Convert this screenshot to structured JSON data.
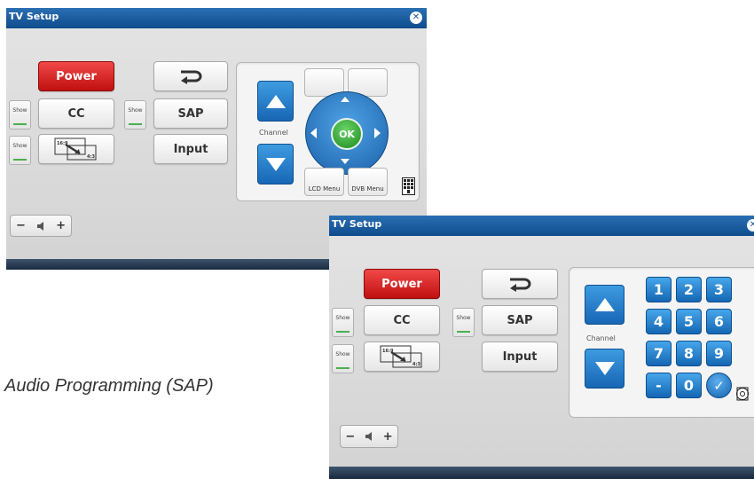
{
  "colors": {
    "titlebar": "#1a5a9a",
    "power": "#d42020",
    "channel_blue": "#2a83d2",
    "ok_green": "#2fa52f",
    "indicator_green": "#4caf50"
  },
  "window1": {
    "title": "TV Setup",
    "close_icon": "close-x-icon",
    "buttons": {
      "power": "Power",
      "cc": "CC",
      "sap": "SAP",
      "input": "Input",
      "back_icon": "return-arrow-icon"
    },
    "show_labels": [
      "Show",
      "Show",
      "Show"
    ],
    "aspect": {
      "a": "16:9",
      "b": "4:3"
    },
    "nav": {
      "channel_label": "Channel",
      "ok": "OK",
      "lcd_menu": "LCD Menu",
      "dvb_menu": "DVB Menu",
      "keypad_icon": "keypad-icon"
    },
    "volume": {
      "minus": "−",
      "icon": "speaker-icon",
      "plus": "+"
    }
  },
  "window2": {
    "title": "TV Setup",
    "close_icon": "close-x-icon",
    "buttons": {
      "power": "Power",
      "cc": "CC",
      "sap": "SAP",
      "input": "Input",
      "back_icon": "return-arrow-icon"
    },
    "show_labels": [
      "Show",
      "Show",
      "Show"
    ],
    "aspect": {
      "a": "16:9",
      "b": "4:3"
    },
    "keypad": {
      "channel_label": "Channel",
      "keys": [
        "1",
        "2",
        "3",
        "4",
        "5",
        "6",
        "7",
        "8",
        "9",
        "-",
        "0"
      ],
      "enter_icon": "checkmark-icon",
      "dpad_icon": "dpad-icon"
    },
    "volume": {
      "minus": "−",
      "icon": "speaker-icon",
      "plus": "+"
    }
  },
  "caption": "Audio Programming (SAP)"
}
